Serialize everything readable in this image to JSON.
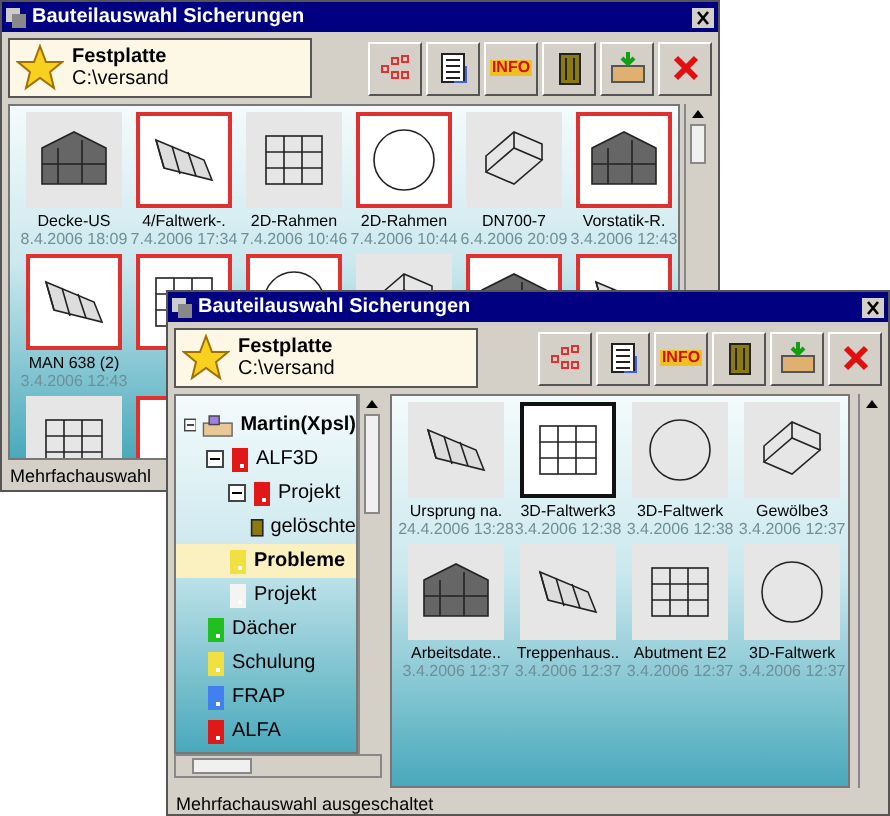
{
  "back_window": {
    "title": "Bauteilauswahl Sicherungen",
    "location": {
      "name": "Festplatte",
      "path": "C:\\versand"
    },
    "info_label": "INFO",
    "items": [
      {
        "label": "Decke-US",
        "date": "8.4.2006 18:09",
        "marked": false
      },
      {
        "label": "4/Faltwerk-.",
        "date": "7.4.2006 17:34",
        "marked": true
      },
      {
        "label": "2D-Rahmen",
        "date": "7.4.2006 10:46",
        "marked": false
      },
      {
        "label": "2D-Rahmen",
        "date": "7.4.2006 10:44",
        "marked": true
      },
      {
        "label": "DN700-7",
        "date": "6.4.2006 20:09",
        "marked": false
      },
      {
        "label": "Vorstatik-R.",
        "date": "3.4.2006 12:43",
        "marked": true
      },
      {
        "label": "MAN 638 (2)",
        "date": "3.4.2006 12:43",
        "marked": true
      },
      {
        "marked": true
      },
      {
        "marked": true
      },
      {
        "marked": false
      },
      {
        "marked": true
      },
      {
        "marked": true
      },
      {
        "marked": false
      },
      {
        "marked": true
      }
    ],
    "status": "Mehrfachauswahl"
  },
  "front_window": {
    "title": "Bauteilauswahl Sicherungen",
    "location": {
      "name": "Festplatte",
      "path": "C:\\versand"
    },
    "info_label": "INFO",
    "tree": [
      {
        "label": "Martin(Xpsl)",
        "kind": "computer",
        "expanded": true,
        "selected": false,
        "children": [
          {
            "label": "ALF3D",
            "kind": "folder",
            "color": "#e01818",
            "expanded": true,
            "selected": false,
            "children": [
              {
                "label": "Projekt",
                "kind": "folder",
                "color": "#e01818",
                "expanded": true,
                "selected": false,
                "children": [
                  {
                    "label": "gelöschte",
                    "kind": "trash",
                    "selected": false
                  }
                ]
              },
              {
                "label": "Probleme",
                "kind": "folder",
                "color": "#f0e040",
                "selected": true
              },
              {
                "label": "Projekt",
                "kind": "folder",
                "color": "#f4f4f4",
                "selected": false
              }
            ]
          },
          {
            "label": "Dächer",
            "kind": "folder",
            "color": "#20c020",
            "selected": false
          },
          {
            "label": "Schulung",
            "kind": "folder",
            "color": "#f0e040",
            "selected": false
          },
          {
            "label": "FRAP",
            "kind": "folder",
            "color": "#4080f0",
            "selected": false
          },
          {
            "label": "ALFA",
            "kind": "folder",
            "color": "#e01818",
            "selected": false
          }
        ]
      }
    ],
    "items": [
      {
        "label": "Ursprung na.",
        "date": "24.4.2006 13:28",
        "selected": false
      },
      {
        "label": "3D-Faltwerk3",
        "date": "3.4.2006 12:38",
        "selected": true
      },
      {
        "label": "3D-Faltwerk",
        "date": "3.4.2006 12:38",
        "selected": false
      },
      {
        "label": "Gewölbe3",
        "date": "3.4.2006 12:37",
        "selected": false
      },
      {
        "label": "Arbeitsdate..",
        "date": "3.4.2006 12:37",
        "selected": false
      },
      {
        "label": "Treppenhaus..",
        "date": "3.4.2006 12:37",
        "selected": false
      },
      {
        "label": "Abutment E2",
        "date": "3.4.2006 12:37",
        "selected": false
      },
      {
        "label": "3D-Faltwerk",
        "date": "3.4.2006 12:37",
        "selected": false
      }
    ],
    "status": "Mehrfachauswahl ausgeschaltet"
  }
}
